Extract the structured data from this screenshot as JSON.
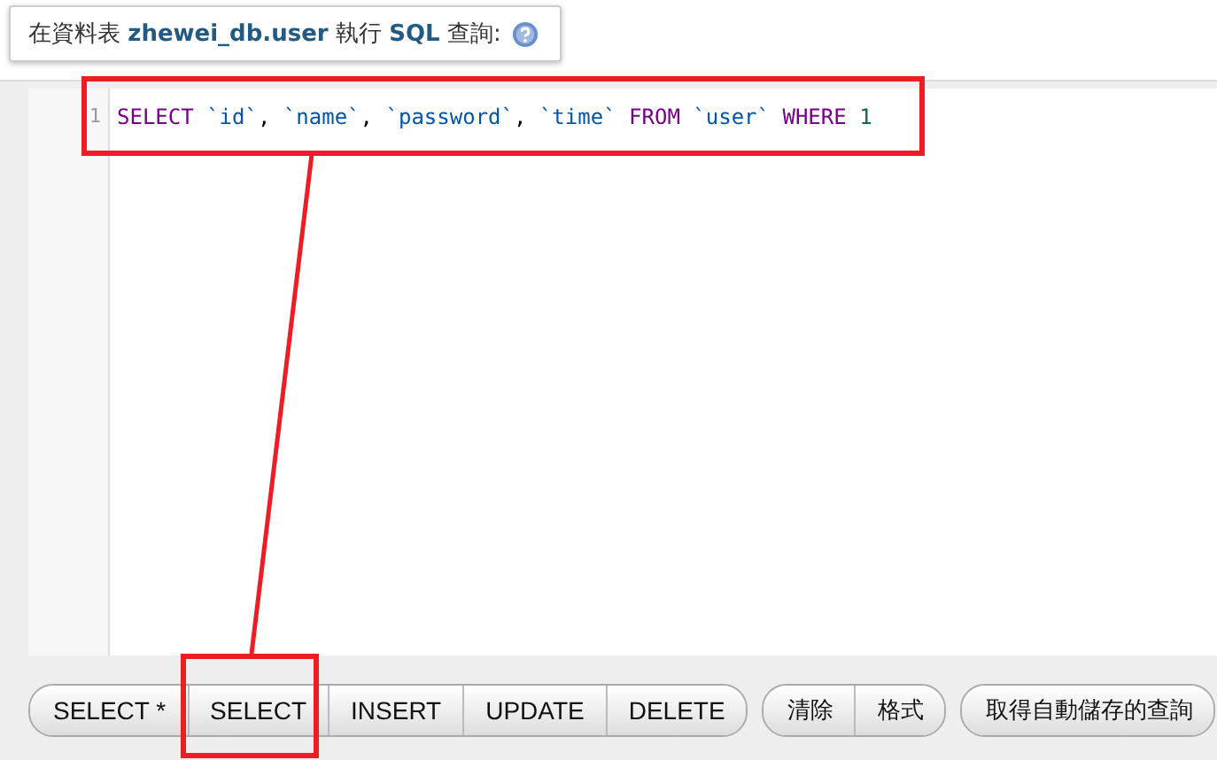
{
  "legend": {
    "text": "在資料表 **zhewei_db.user** 執行 **SQL** 查詢:"
  },
  "editor": {
    "lines": [
      {
        "number": "1",
        "tokens": [
          {
            "text": "SELECT ",
            "kind": "keyword"
          },
          {
            "text": "`id`",
            "kind": "identifier"
          },
          {
            "text": ", ",
            "kind": "plain"
          },
          {
            "text": "`name`",
            "kind": "identifier"
          },
          {
            "text": ", ",
            "kind": "plain"
          },
          {
            "text": "`password`",
            "kind": "identifier"
          },
          {
            "text": ", ",
            "kind": "plain"
          },
          {
            "text": "`time` ",
            "kind": "identifier"
          },
          {
            "text": "FROM ",
            "kind": "keyword"
          },
          {
            "text": "`user` ",
            "kind": "identifier"
          },
          {
            "text": "WHERE ",
            "kind": "keyword"
          },
          {
            "text": "1",
            "kind": "number"
          }
        ]
      }
    ]
  },
  "button_groups": [
    [
      {
        "label": "SELECT *"
      },
      {
        "label": "SELECT"
      },
      {
        "label": "INSERT"
      },
      {
        "label": "UPDATE"
      },
      {
        "label": "DELETE"
      }
    ],
    [
      {
        "label": "清除"
      },
      {
        "label": "格式"
      }
    ],
    [
      {
        "label": "取得自動儲存的查詢"
      }
    ]
  ]
}
